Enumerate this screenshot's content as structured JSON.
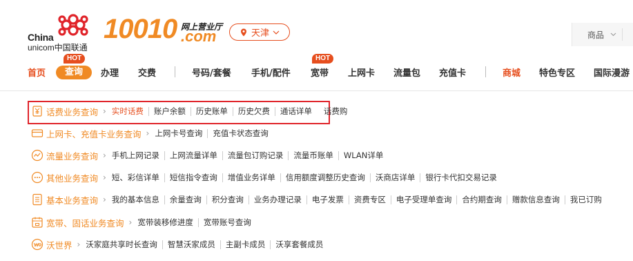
{
  "logo": {
    "china": "China",
    "unicom": "unicom中国联通"
  },
  "brand": {
    "number": "10010",
    "sub": "网上营业厅",
    "com": ".com"
  },
  "city": {
    "name": "天津"
  },
  "topright": {
    "goods_label": "商品",
    "extra": "i"
  },
  "colors": {
    "accent": "#f08a24",
    "red": "#e64e1e",
    "highlight_box": "#e0242a"
  },
  "nav": {
    "hot_badge": "HOT",
    "items": [
      "首页",
      "查询",
      "办理",
      "交费",
      "号码/套餐",
      "手机/配件",
      "宽带",
      "上网卡",
      "流量包",
      "充值卡",
      "商城",
      "特色专区",
      "国际漫游"
    ]
  },
  "rows": [
    {
      "icon": "yuan-icon",
      "category": "话费业务查询",
      "links": [
        "实时话费",
        "账户余额",
        "历史账单",
        "历史欠费",
        "通话详单",
        "话费购"
      ]
    },
    {
      "icon": "card-icon",
      "category": "上网卡、充值卡业务查询",
      "links": [
        "上网卡号查询",
        "充值卡状态查询"
      ]
    },
    {
      "icon": "traffic-icon",
      "category": "流量业务查询",
      "links": [
        "手机上网记录",
        "上网流量详单",
        "流量包订购记录",
        "流量币账单",
        "WLAN详单"
      ]
    },
    {
      "icon": "chat-icon",
      "category": "其他业务查询",
      "links": [
        "短、彩信详单",
        "短信指令查询",
        "增值业务详单",
        "信用额度调整历史查询",
        "沃商店详单",
        "银行卡代扣交易记录"
      ]
    },
    {
      "icon": "document-icon",
      "category": "基本业务查询",
      "links": [
        "我的基本信息",
        "余量查询",
        "积分查询",
        "业务办理记录",
        "电子发票",
        "资费专区",
        "电子受理单查询",
        "合约期查询",
        "赠款信息查询",
        "我已订购"
      ]
    },
    {
      "icon": "broadband-icon",
      "category": "宽带、固话业务查询",
      "links": [
        "宽带装移修进度",
        "宽带账号查询"
      ]
    },
    {
      "icon": "wo-icon",
      "category": "沃世界",
      "links": [
        "沃家庭共享时长查询",
        "智慧沃家成员",
        "主副卡成员",
        "沃享套餐成员"
      ]
    }
  ]
}
